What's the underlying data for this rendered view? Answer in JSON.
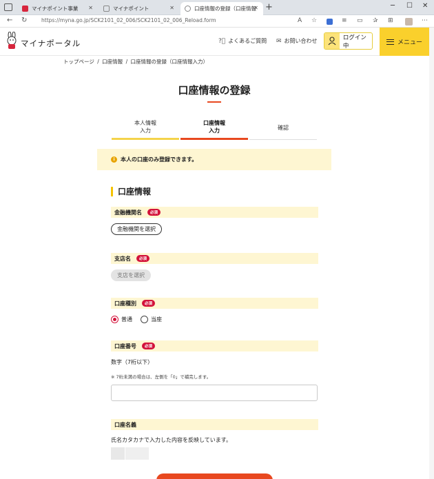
{
  "browser": {
    "tabs": [
      {
        "title": "マイナポイント事業",
        "active": false
      },
      {
        "title": "マイナポイント",
        "active": false
      },
      {
        "title": "口座情報の登録（口座情報入力）",
        "active": true
      }
    ],
    "url": "https://myna.go.jp/SCK2101_02_006/SCK2101_02_006_Reload.form"
  },
  "header": {
    "logo_text": "マイナポータル",
    "faq": "よくあるご質問",
    "contact": "お問い合わせ",
    "login": "ログイン中",
    "menu": "メニュー"
  },
  "breadcrumb": [
    "トップページ",
    "/",
    "口座情報",
    "/",
    "口座情報の登録（口座情報入力）"
  ],
  "page_title": "口座情報の登録",
  "steps": [
    {
      "line1": "本人情報",
      "line2": "入力"
    },
    {
      "line1": "口座情報",
      "line2": "入力"
    },
    {
      "line1": "確認",
      "line2": ""
    }
  ],
  "notice": "本人の口座のみ登録できます。",
  "section_title": "口座情報",
  "required_badge": "必須",
  "fields": {
    "bank": {
      "label": "金融機関名",
      "button": "金融機関を選択"
    },
    "branch": {
      "label": "支店名",
      "button": "支店を選択"
    },
    "account_type": {
      "label": "口座種別",
      "options": [
        "普通",
        "当座"
      ]
    },
    "account_number": {
      "label": "口座番号",
      "hint": "数字（7桁以下）",
      "note": "※ 7桁未満の場合は、左側を「0」で補完します。"
    },
    "account_holder": {
      "label": "口座名義",
      "hint": "氏名カタカナで入力した内容を反映しています。"
    }
  },
  "colors": {
    "accent_yellow": "#fad02c",
    "accent_red": "#e8481f",
    "required_red": "#d3123a",
    "notice_bg": "#fef6d2"
  }
}
